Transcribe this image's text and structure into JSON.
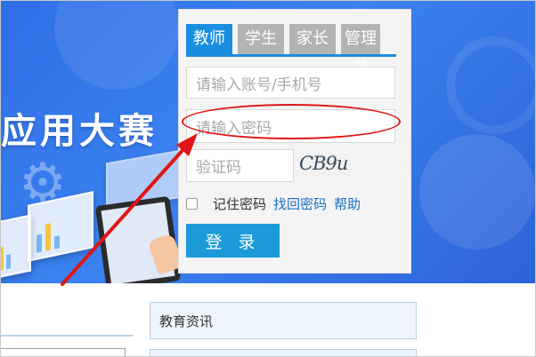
{
  "banner": {
    "title_partial": "应用大赛"
  },
  "login": {
    "tabs": [
      {
        "label": "教师",
        "active": true
      },
      {
        "label": "学生",
        "active": false
      },
      {
        "label": "家长",
        "active": false
      },
      {
        "label": "管理员",
        "active": false
      }
    ],
    "account_placeholder": "请输入账号/手机号",
    "password_placeholder": "请输入密码",
    "captcha_placeholder": "验证码",
    "captcha_image_text": "CB9u",
    "remember_label": "记住密码",
    "forgot_link": "找回密码",
    "help_link": "帮助",
    "login_button": "登 录"
  },
  "bottom": {
    "news_title": "教育资讯"
  },
  "colors": {
    "accent": "#1a8fe0",
    "annotation": "#e01515",
    "banner": "#2f6fe6"
  }
}
